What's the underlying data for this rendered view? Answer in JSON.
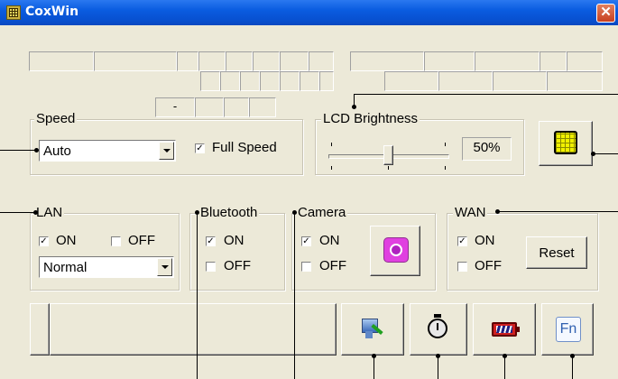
{
  "window": {
    "title": "CoxWin",
    "close_glyph": "✕"
  },
  "status_row": {
    "dash": "-"
  },
  "speed": {
    "legend": "Speed",
    "mode": "Auto",
    "full_speed_label": "Full Speed",
    "full_speed_checked": true
  },
  "lcd": {
    "legend": "LCD Brightness",
    "value": "50%",
    "level": 0.5
  },
  "lan": {
    "legend": "LAN",
    "on_label": "ON",
    "off_label": "OFF",
    "on_checked": true,
    "mode": "Normal"
  },
  "bluetooth": {
    "legend": "Bluetooth",
    "on_label": "ON",
    "off_label": "OFF",
    "on_checked": true
  },
  "camera": {
    "legend": "Camera",
    "on_label": "ON",
    "off_label": "OFF",
    "on_checked": true
  },
  "wan": {
    "legend": "WAN",
    "on_label": "ON",
    "off_label": "OFF",
    "on_checked": true,
    "reset_label": "Reset"
  },
  "toolbar": {
    "fn_label": "Fn",
    "icons": [
      "display-settings-icon",
      "stopwatch-icon",
      "battery-icon",
      "fn-key-icon"
    ]
  },
  "colors": {
    "titlebar": "#0a5ce0",
    "window_bg": "#ece9d8",
    "camera_icon": "#e040e0",
    "lcd_icon": "#f0f000"
  }
}
